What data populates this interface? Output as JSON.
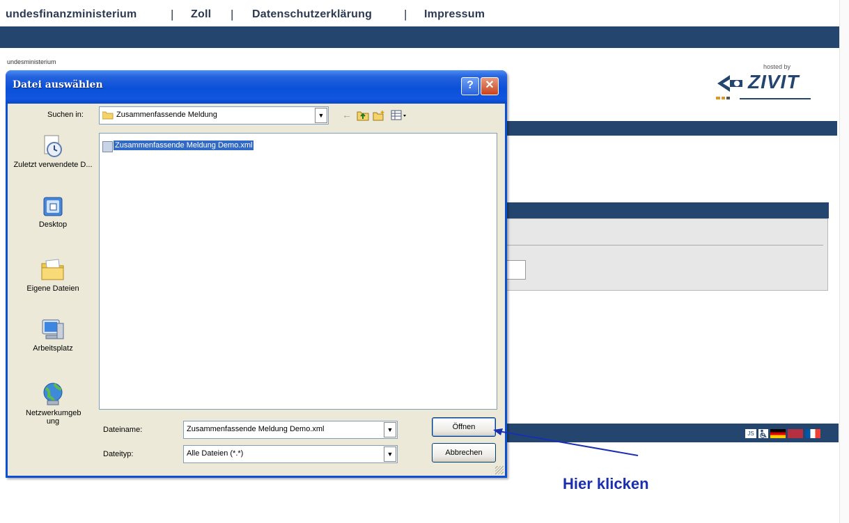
{
  "nav": {
    "items": [
      "undesfinanzministerium",
      "Zoll",
      "Datenschutzerklärung",
      "Impressum"
    ],
    "separator": "|"
  },
  "header": {
    "ministry_text": "undesministerium",
    "hosted_by": "hosted by",
    "logo_text": "ZIVIT"
  },
  "dialog": {
    "title": "Datei auswählen",
    "help_glyph": "?",
    "close_glyph": "✕",
    "look_in_label": "Suchen in:",
    "look_in_value": "Zusammenfassende Meldung",
    "places": [
      {
        "label": "Zuletzt verwendete D...",
        "icon": "recent-documents-icon"
      },
      {
        "label": "Desktop",
        "icon": "desktop-icon"
      },
      {
        "label": "Eigene Dateien",
        "icon": "my-documents-icon"
      },
      {
        "label": "Arbeitsplatz",
        "icon": "my-computer-icon"
      },
      {
        "label": "Netzwerkumgeb ung",
        "icon": "network-places-icon"
      }
    ],
    "files": [
      {
        "name": "Zusammenfassende Meldung Demo.xml",
        "selected": true
      }
    ],
    "filename_label": "Dateiname:",
    "filename_value": "Zusammenfassende Meldung Demo.xml",
    "filetype_label": "Dateityp:",
    "filetype_value": "Alle Dateien (*.*)",
    "open_button": "Öffnen",
    "cancel_button": "Abbrechen"
  },
  "annotation": {
    "text": "Hier klicken",
    "color": "#1a2fb0"
  },
  "colors": {
    "page_bar": "#24466e",
    "titlebar": "#0a50d8",
    "dialog_face": "#ece9d8",
    "selection": "#316ac5"
  }
}
